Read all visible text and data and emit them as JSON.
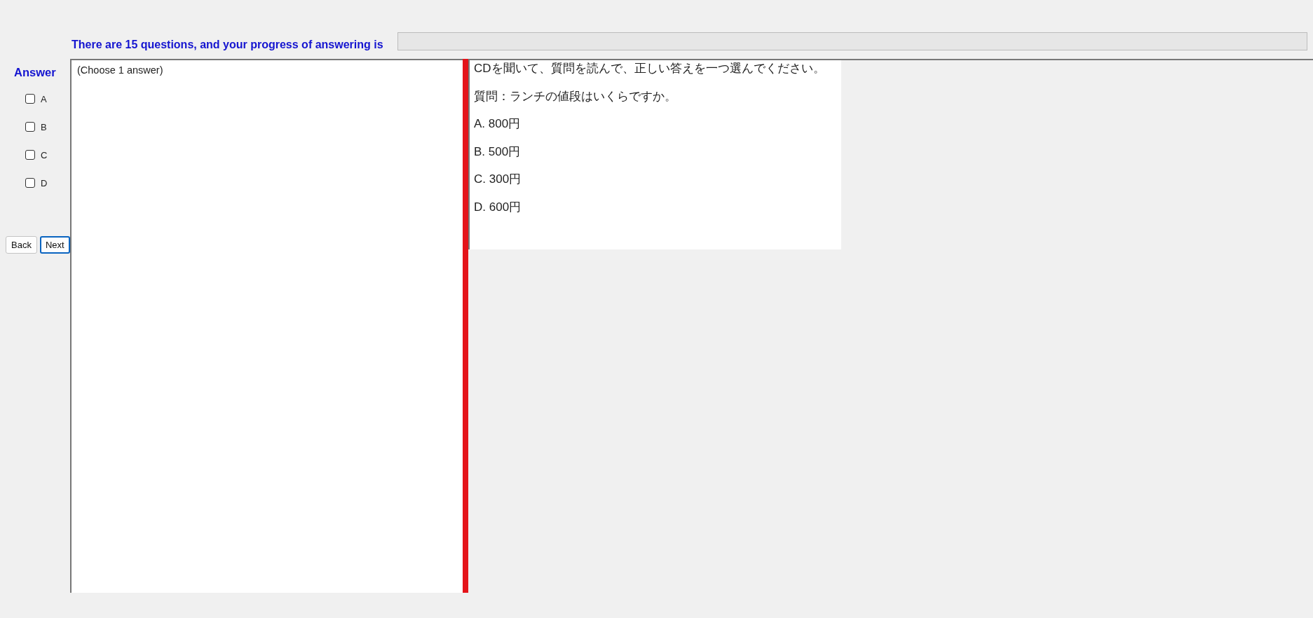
{
  "progress": {
    "text": "There are 15 questions, and your progress of answering is",
    "level": 0
  },
  "answer": {
    "label": "Answer",
    "options": [
      {
        "label": "A",
        "checked": false
      },
      {
        "label": "B",
        "checked": false
      },
      {
        "label": "C",
        "checked": false
      },
      {
        "label": "D",
        "checked": false
      }
    ]
  },
  "buttons": [
    {
      "label": "Back",
      "focused": false
    },
    {
      "label": "Next",
      "focused": true
    }
  ],
  "instruction": "(Choose 1 answer)",
  "question": {
    "lines": [
      "CDを聞いて、質問を読んで、正しい答えを一つ選んでください。",
      "質問：ランチの値段はいくらですか。",
      "A.  800円",
      "B.  500円",
      "C.  300円",
      "D.  600円"
    ]
  }
}
